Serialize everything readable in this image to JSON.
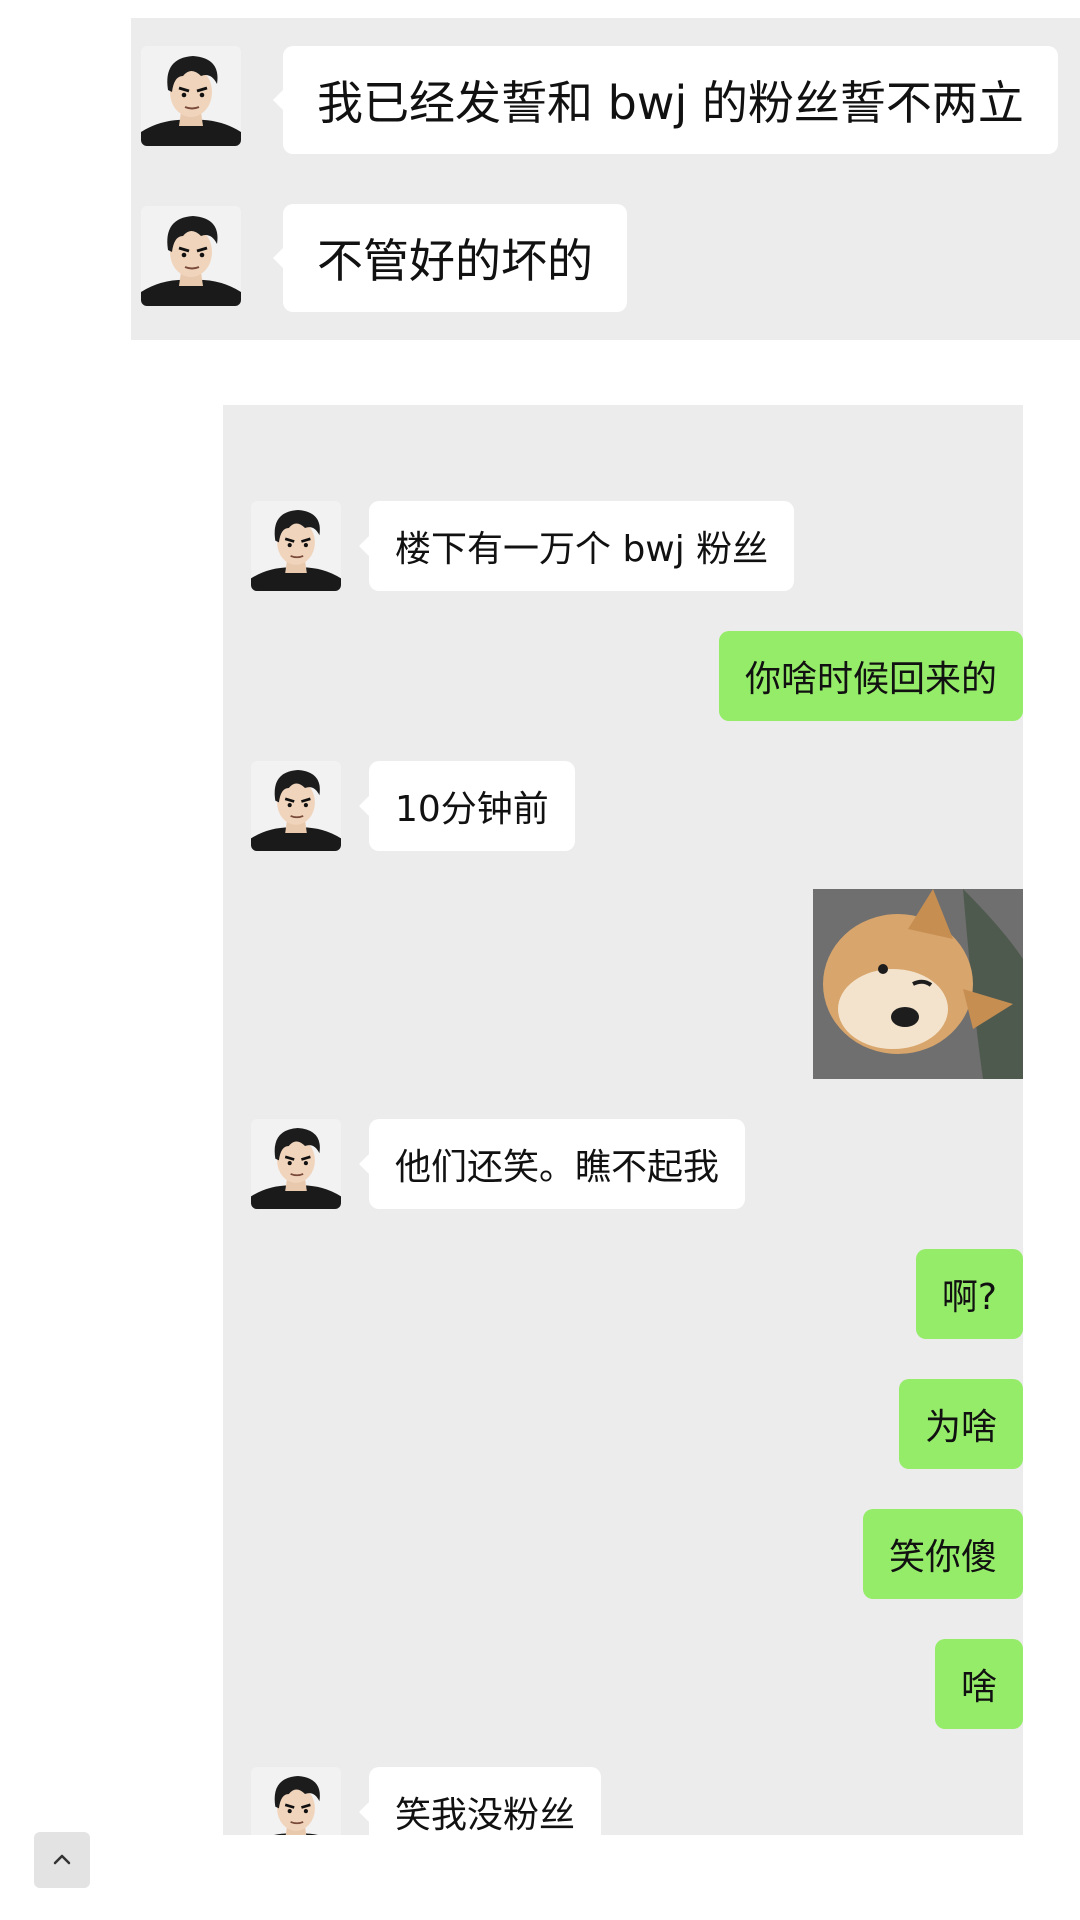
{
  "top_messages": [
    {
      "text": "我已经发誓和 bwj 的粉丝誓不两立"
    },
    {
      "text": "不管好的坏的"
    }
  ],
  "chat": {
    "messages": [
      {
        "side": "left",
        "text": "楼下有一万个 bwj 粉丝"
      },
      {
        "side": "right",
        "text": "你啥时候回来的"
      },
      {
        "side": "left",
        "text": "10分钟前"
      },
      {
        "side": "right",
        "type": "image",
        "content": "shiba-dog-sticker"
      },
      {
        "side": "left",
        "text": "他们还笑。瞧不起我"
      },
      {
        "side": "right",
        "text": "啊?"
      },
      {
        "side": "right",
        "text": "为啥"
      },
      {
        "side": "right",
        "text": "笑你傻"
      },
      {
        "side": "right",
        "text": "啥"
      },
      {
        "side": "left",
        "text": "笑我没粉丝"
      }
    ]
  },
  "colors": {
    "chat_background": "#ececec",
    "incoming_bubble": "#ffffff",
    "outgoing_bubble": "#95ec69"
  },
  "icons": {
    "scroll_top": "chevron-up-icon"
  }
}
